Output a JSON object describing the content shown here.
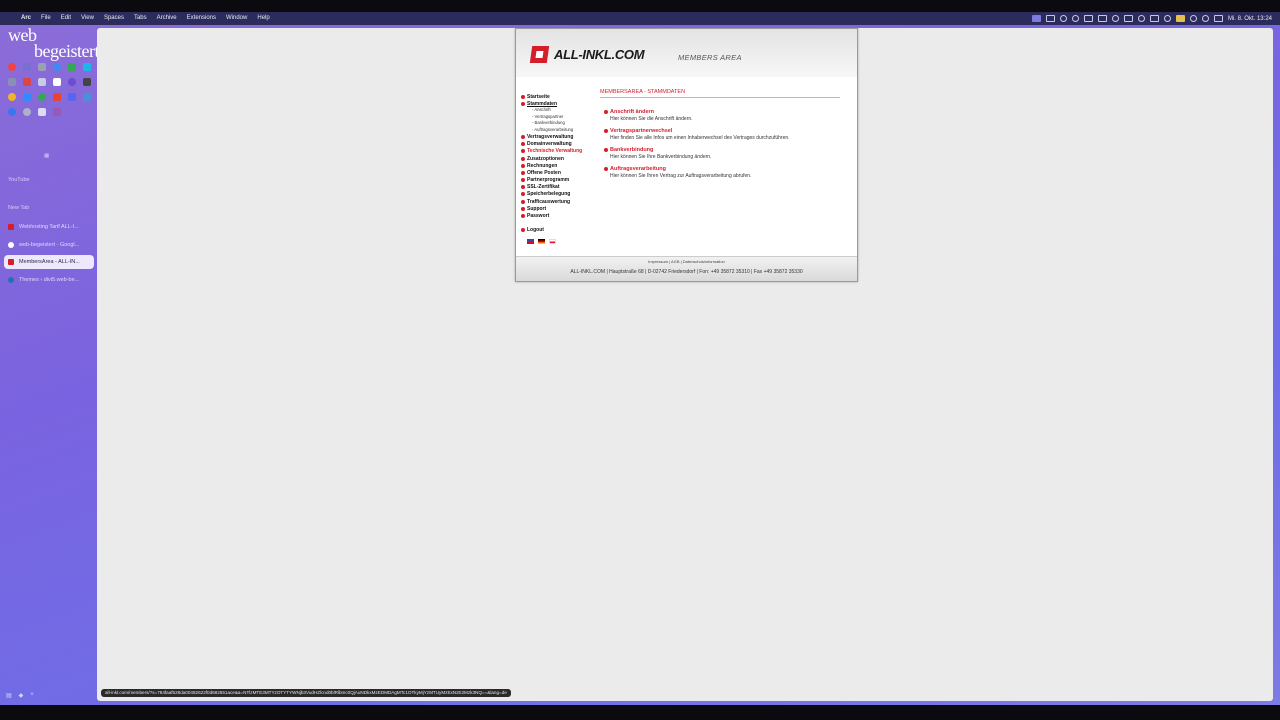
{
  "menubar": {
    "app": "Arc",
    "menus": [
      "File",
      "Edit",
      "View",
      "Spaces",
      "Tabs",
      "Archive",
      "Extensions",
      "Window",
      "Help"
    ],
    "clock": "Mi. 8. Okt. 13:24"
  },
  "sidebar": {
    "logo_line1": "web",
    "logo_line2": "begeistert.de",
    "section_youtube": "YouTube",
    "section_newtab": "New Tab",
    "tabs": [
      {
        "label": "Webhosting Tarif ALL-I...",
        "color": "#d41f2b",
        "active": false
      },
      {
        "label": "web-begeistert - Googl...",
        "color": "#ffffff",
        "active": false
      },
      {
        "label": "MembersArea - ALL-IN...",
        "color": "#d41f2b",
        "active": true
      },
      {
        "label": "Themes ‹ divi5.web-be...",
        "color": "#2271b1",
        "active": false
      }
    ]
  },
  "allinkl": {
    "brand": "ALL-INKL.COM",
    "members_area": "MEMBERS AREA",
    "menu": [
      {
        "label": "Startseite",
        "state": ""
      },
      {
        "label": "Stammdaten",
        "state": "current"
      }
    ],
    "submenu": [
      "- Anschrift",
      "- Vertragspartner",
      "- Bankverbindung",
      "- Auftragsverarbeitung"
    ],
    "menu_rest": [
      {
        "label": "Vertragsverwaltung",
        "state": ""
      },
      {
        "label": "Domainverwaltung",
        "state": ""
      },
      {
        "label": "Technische Verwaltung",
        "state": "hover"
      },
      {
        "label": "Zusatzoptionen",
        "state": ""
      },
      {
        "label": "Rechnungen",
        "state": ""
      },
      {
        "label": "Offene Posten",
        "state": ""
      },
      {
        "label": "Partnerprogramm",
        "state": ""
      },
      {
        "label": "SSL-Zertifikat",
        "state": ""
      },
      {
        "label": "Speicherbelegung",
        "state": ""
      },
      {
        "label": "Trafficauswertung",
        "state": ""
      },
      {
        "label": "Support",
        "state": ""
      },
      {
        "label": "Passwort",
        "state": ""
      }
    ],
    "logout": "Logout",
    "page_title": "MEMBERSAREA - STAMMDATEN",
    "entries": [
      {
        "title": "Anschrift ändern",
        "desc": "Hier können Sie die Anschrift ändern."
      },
      {
        "title": "Vertragspartnerwechsel",
        "desc": "Hier finden Sie alle Infos um einen Inhaberwechsel des Vertrages durchzuführen."
      },
      {
        "title": "Bankverbindung",
        "desc": "Hier können Sie Ihre Bankverbindung ändern."
      },
      {
        "title": "Auftragsverarbeitung",
        "desc": "Hier können Sie Ihren Vertrag zur Auftragsverarbeitung abrufen."
      }
    ],
    "footer_links": "Impressum | AGB | Datenschutzinformation",
    "footer_address": "ALL-INKL.COM | Hauptstraße 68 | D-02742 Friedersdorf | Fon: +49 35872 35310 | Fax +49 35872 35330"
  },
  "status_url": "all-inkl.com/members/?s=784faaf528da00482622f0d682651ace&a=NTlzMTE3MTYzOTYTYWNjb3VudHZlcnd0blRlbmc0QjAuNDkxMzEDMDAgMTc1OTkyMjYzMTUyMzExNzE2Mzk3NQ==&lang=de",
  "colors": {
    "brand_red": "#d41f2b",
    "arc_purple": "#7a63e0"
  }
}
